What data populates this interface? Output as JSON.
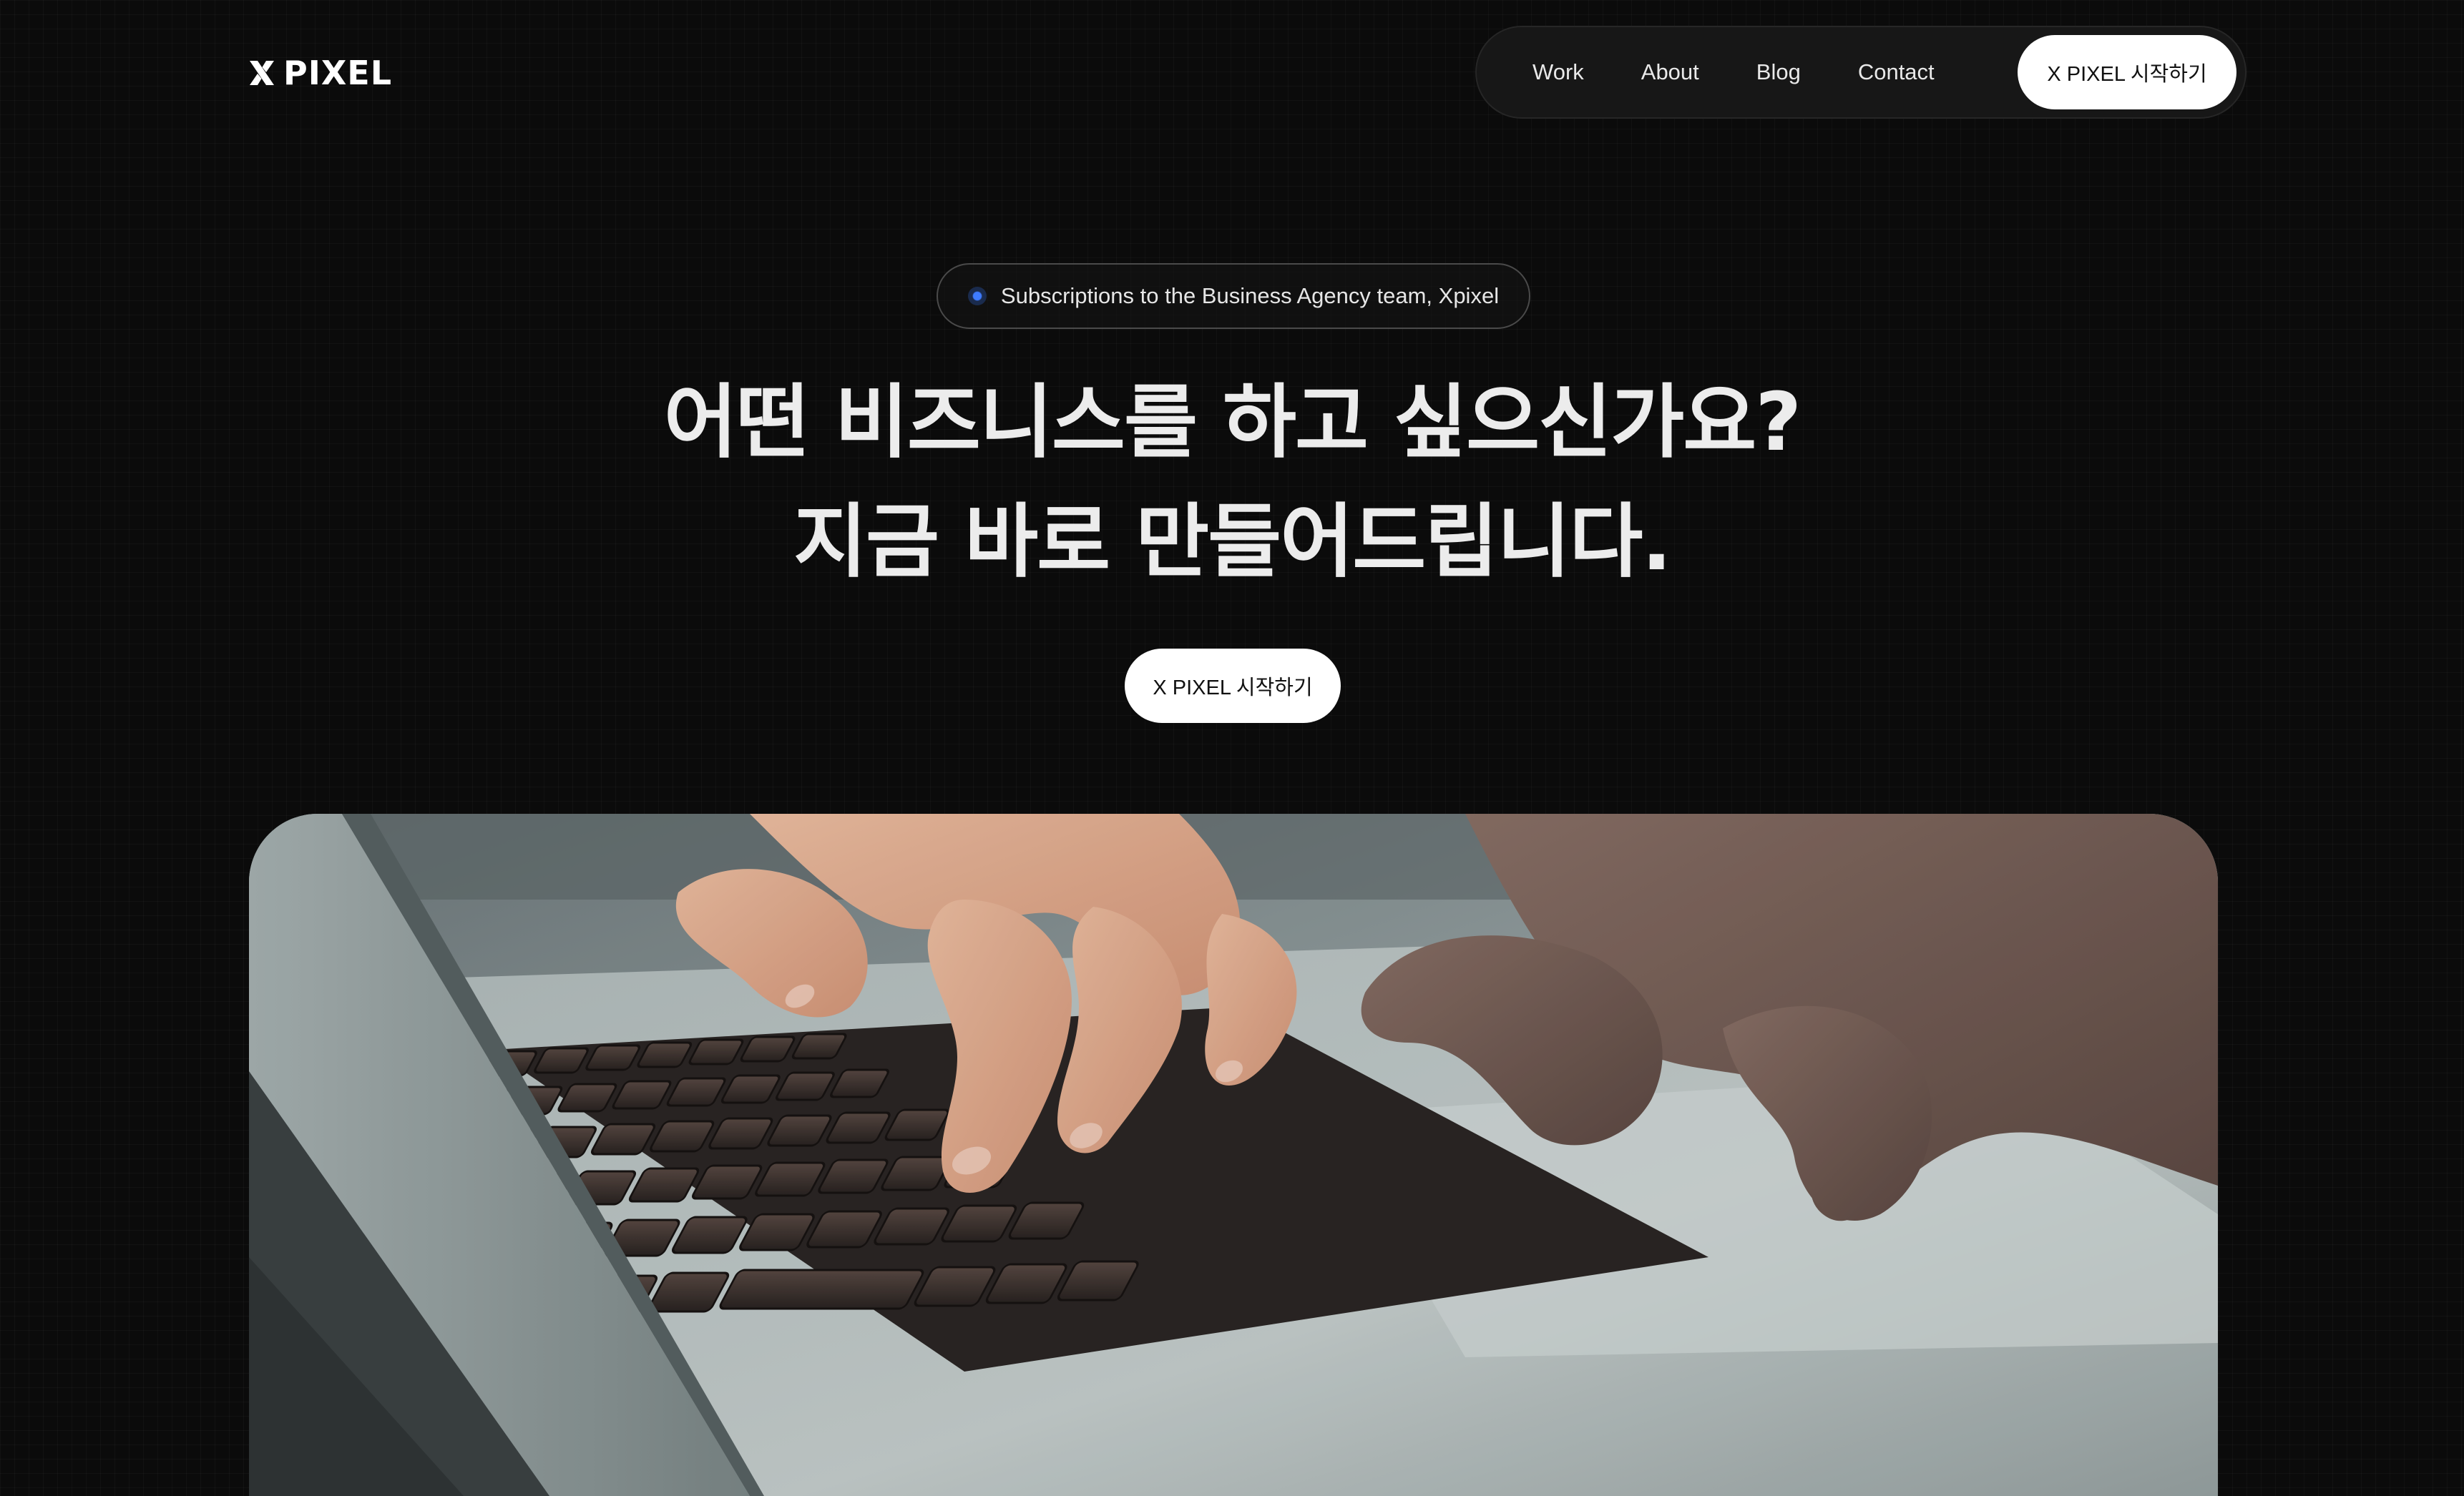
{
  "brand": {
    "logo_icon": "x-logo-icon",
    "name": "PIXEL"
  },
  "nav": {
    "links": [
      {
        "label": "Work"
      },
      {
        "label": "About"
      },
      {
        "label": "Blog"
      },
      {
        "label": "Contact"
      }
    ],
    "cta_label": "X PIXEL 시작하기"
  },
  "hero": {
    "badge": {
      "icon": "blue-dot-icon",
      "text": "Subscriptions to the Business Agency team, Xpixel"
    },
    "headline_line1": "어떤 비즈니스를 하고 싶으신가요?",
    "headline_line2": "지금 바로 만들어드립니다.",
    "cta_label": "X PIXEL 시작하기"
  },
  "colors": {
    "background": "#0b0b0b",
    "nav_background": "#171717",
    "button_background": "#ffffff",
    "button_text": "#111111",
    "accent_dot": "#3e7bff",
    "headline_text": "#ececec"
  }
}
